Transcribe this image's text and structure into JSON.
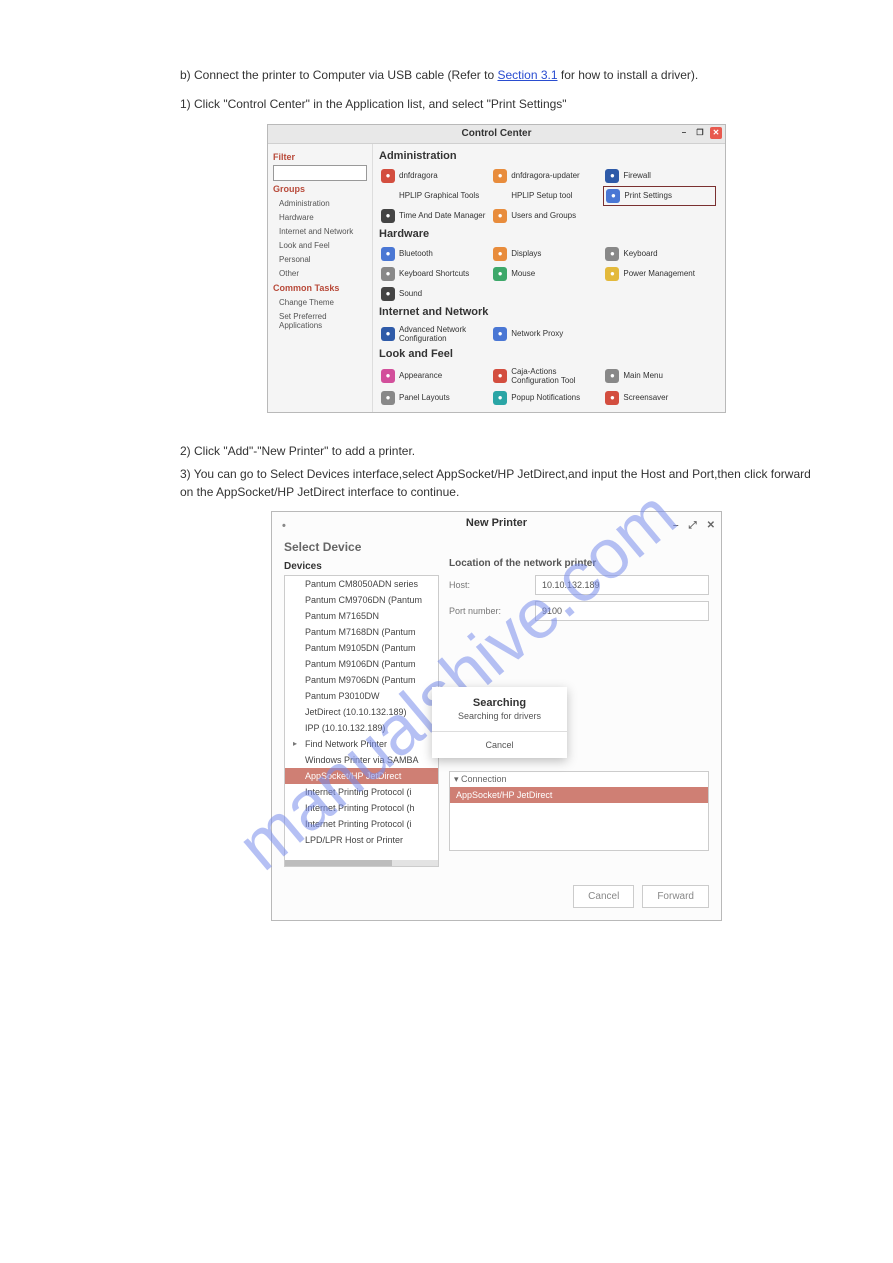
{
  "watermark_text": "manualshive.com",
  "doc": {
    "line1_pre": "b) Connect the printer to Computer via USB cable (Refer to ",
    "line1_link": "Section 3.1",
    "line1_post": " for how to install a driver).",
    "step1": "1) Click \"Control Center\" in the Application list, and select \"Print Settings\"",
    "step2": "2) Click \"Add\"-\"New Printer\" to add a printer.",
    "step3": "3) You can go to Select Devices interface,select AppSocket/HP JetDirect,and input the Host and Port,then click forward on the AppSocket/HP JetDirect interface to continue."
  },
  "cc": {
    "title": "Control Center",
    "filter": "Filter",
    "groups": "Groups",
    "groups_list": [
      "Administration",
      "Hardware",
      "Internet and Network",
      "Look and Feel",
      "Personal",
      "Other"
    ],
    "common_tasks": "Common Tasks",
    "tasks_list": [
      "Change Theme",
      "Set Preferred Applications"
    ],
    "sections": [
      {
        "name": "Administration",
        "items": [
          {
            "label": "dnfdragora",
            "c": "ic-red"
          },
          {
            "label": "dnfdragora-updater",
            "c": "ic-orange"
          },
          {
            "label": "Firewall",
            "c": "ic-darkblue"
          },
          {
            "label": "HPLIP Graphical Tools",
            "c": "ic-blank"
          },
          {
            "label": "HPLIP Setup tool",
            "c": "ic-blank"
          },
          {
            "label": "Print Settings",
            "c": "ic-blue",
            "hl": true
          },
          {
            "label": "Time And Date Manager",
            "c": "ic-black"
          },
          {
            "label": "Users and Groups",
            "c": "ic-orange"
          }
        ]
      },
      {
        "name": "Hardware",
        "items": [
          {
            "label": "Bluetooth",
            "c": "ic-blue"
          },
          {
            "label": "Displays",
            "c": "ic-orange"
          },
          {
            "label": "Keyboard",
            "c": "ic-gray"
          },
          {
            "label": "Keyboard Shortcuts",
            "c": "ic-gray"
          },
          {
            "label": "Mouse",
            "c": "ic-green"
          },
          {
            "label": "Power Management",
            "c": "ic-yellow"
          },
          {
            "label": "Sound",
            "c": "ic-black"
          }
        ]
      },
      {
        "name": "Internet and Network",
        "items": [
          {
            "label": "Advanced Network Configuration",
            "c": "ic-darkblue"
          },
          {
            "label": "Network Proxy",
            "c": "ic-blue"
          }
        ]
      },
      {
        "name": "Look and Feel",
        "items": [
          {
            "label": "Appearance",
            "c": "ic-pink"
          },
          {
            "label": "Caja-Actions Configuration Tool",
            "c": "ic-red"
          },
          {
            "label": "Main Menu",
            "c": "ic-gray"
          },
          {
            "label": "Panel Layouts",
            "c": "ic-gray"
          },
          {
            "label": "Popup Notifications",
            "c": "ic-teal"
          },
          {
            "label": "Screensaver",
            "c": "ic-red"
          }
        ]
      }
    ]
  },
  "np": {
    "title": "New Printer",
    "select_device": "Select Device",
    "devices": "Devices",
    "list": [
      "Pantum CM8050ADN series",
      "Pantum CM9706DN (Pantum",
      "Pantum M7165DN",
      "Pantum M7168DN (Pantum",
      "Pantum M9105DN (Pantum",
      "Pantum M9106DN (Pantum",
      "Pantum M9706DN (Pantum",
      "Pantum P3010DW",
      "JetDirect (10.10.132.189)",
      "IPP (10.10.132.189)",
      "Find Network Printer",
      "Windows Printer via SAMBA",
      "AppSocket/HP JetDirect",
      "Internet Printing Protocol (i",
      "Internet Printing Protocol (h",
      "Internet Printing Protocol (i",
      "LPD/LPR Host or Printer"
    ],
    "loc_heading": "Location of the network printer",
    "host_label": "Host:",
    "host_value": "10.10.132.189",
    "port_label": "Port number:",
    "port_value": "9100",
    "conn_head": "Connection",
    "conn_item": "AppSocket/HP JetDirect",
    "cancel": "Cancel",
    "forward": "Forward",
    "popup_title": "Searching",
    "popup_text": "Searching for drivers",
    "popup_cancel": "Cancel"
  }
}
